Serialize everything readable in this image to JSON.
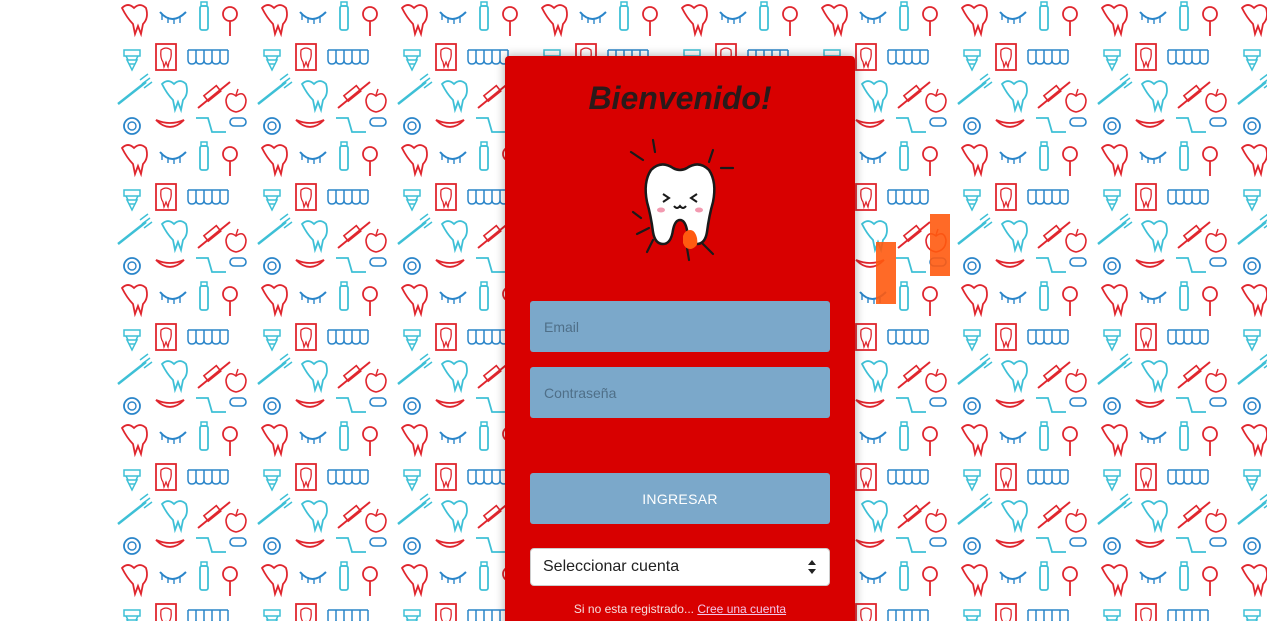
{
  "login": {
    "title": "Bienvenido!",
    "email_placeholder": "Email",
    "password_placeholder": "Contraseña",
    "submit_label": "INGRESAR",
    "account_select": {
      "selected": "Seleccionar cuenta"
    },
    "register_prompt": "Si no esta registrado...",
    "register_link": "Cree una cuenta"
  },
  "colors": {
    "card": "#d80000",
    "input": "#7ba8ca",
    "pattern_red": "#e0262e",
    "pattern_blue": "#2a85c9",
    "pattern_cyan": "#3ec0d6",
    "accent_orange": "#ff5a10"
  },
  "icons": {
    "logo": "tooth-mascot-icon",
    "select": "select-arrows-icon",
    "background": "dental-pattern"
  }
}
